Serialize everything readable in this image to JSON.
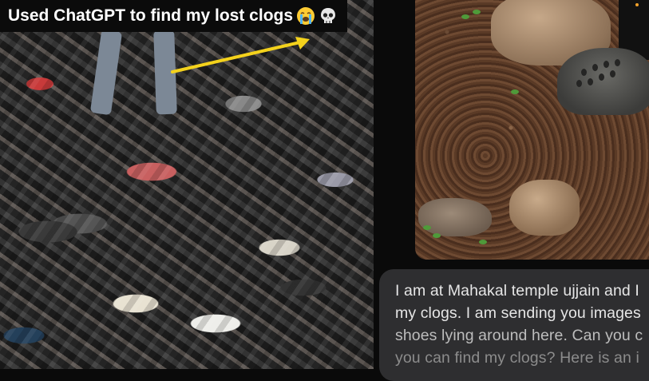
{
  "caption": {
    "text": "Used ChatGPT to find my lost clogs",
    "emoji_1": "loudly-crying-face-icon",
    "emoji_2": "skull-icon"
  },
  "left_photo": {
    "subject": "pile-of-shoes",
    "arrow_color": "#f4d21c"
  },
  "right_photo": {
    "subject": "clog-on-dirt-ground"
  },
  "chat": {
    "lines": [
      "I am at Mahakal temple ujjain and I",
      "my clogs. I am sending you images",
      "shoes lying around here. Can you c",
      "you can find my clogs? Here is an i"
    ],
    "bubble_color": "#2e2e30"
  },
  "colors": {
    "background": "#0a0a0a",
    "caption_text": "#ffffff"
  }
}
